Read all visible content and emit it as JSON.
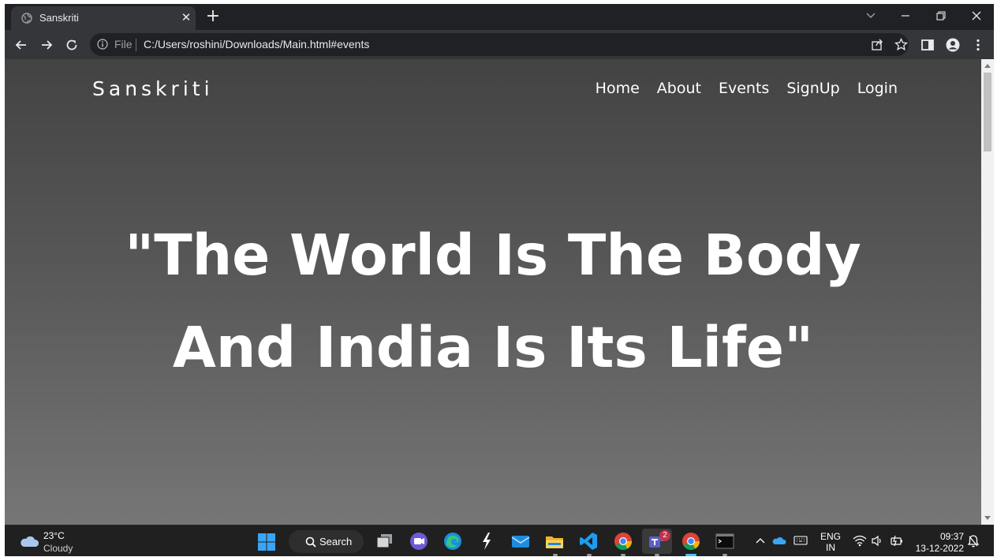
{
  "browser": {
    "tab_title": "Sanskriti",
    "omnibox_scheme": "File",
    "omnibox_url": "C:/Users/roshini/Downloads/Main.html#events"
  },
  "page": {
    "brand": "Sanskriti",
    "nav": [
      "Home",
      "About",
      "Events",
      "SignUp",
      "Login"
    ],
    "hero_line1": "\"The World Is The Body",
    "hero_line2": "And India Is Its Life\""
  },
  "taskbar": {
    "weather_temp": "23°C",
    "weather_condition": "Cloudy",
    "search_label": "Search",
    "teams_badge": "2",
    "lang_line1": "ENG",
    "lang_line2": "IN",
    "time": "09:37",
    "date": "13-12-2022"
  },
  "icons": [
    "globe-icon",
    "close-icon",
    "plus-icon",
    "chevron-down-icon",
    "minimize-icon",
    "restore-icon",
    "back-arrow-icon",
    "forward-arrow-icon",
    "reload-icon",
    "info-icon",
    "share-icon",
    "star-icon",
    "side-panel-icon",
    "profile-icon",
    "kebab-menu-icon",
    "windows-start-icon",
    "search-icon",
    "task-view-icon",
    "chat-icon",
    "edge-icon",
    "bolt-icon",
    "mail-icon",
    "file-explorer-icon",
    "vscode-icon",
    "chrome-icon",
    "teams-icon",
    "terminal-icon",
    "chevron-up-icon",
    "onedrive-icon",
    "keyboard-icon",
    "wifi-icon",
    "volume-icon",
    "battery-icon",
    "notification-icon"
  ],
  "colors": {
    "browser_frame": "#202124",
    "toolbar": "#35363a",
    "page_gradient_top": "#434343",
    "page_gradient_bottom": "#767676",
    "taskbar": "#202020",
    "accent": "#4cc2ff"
  }
}
